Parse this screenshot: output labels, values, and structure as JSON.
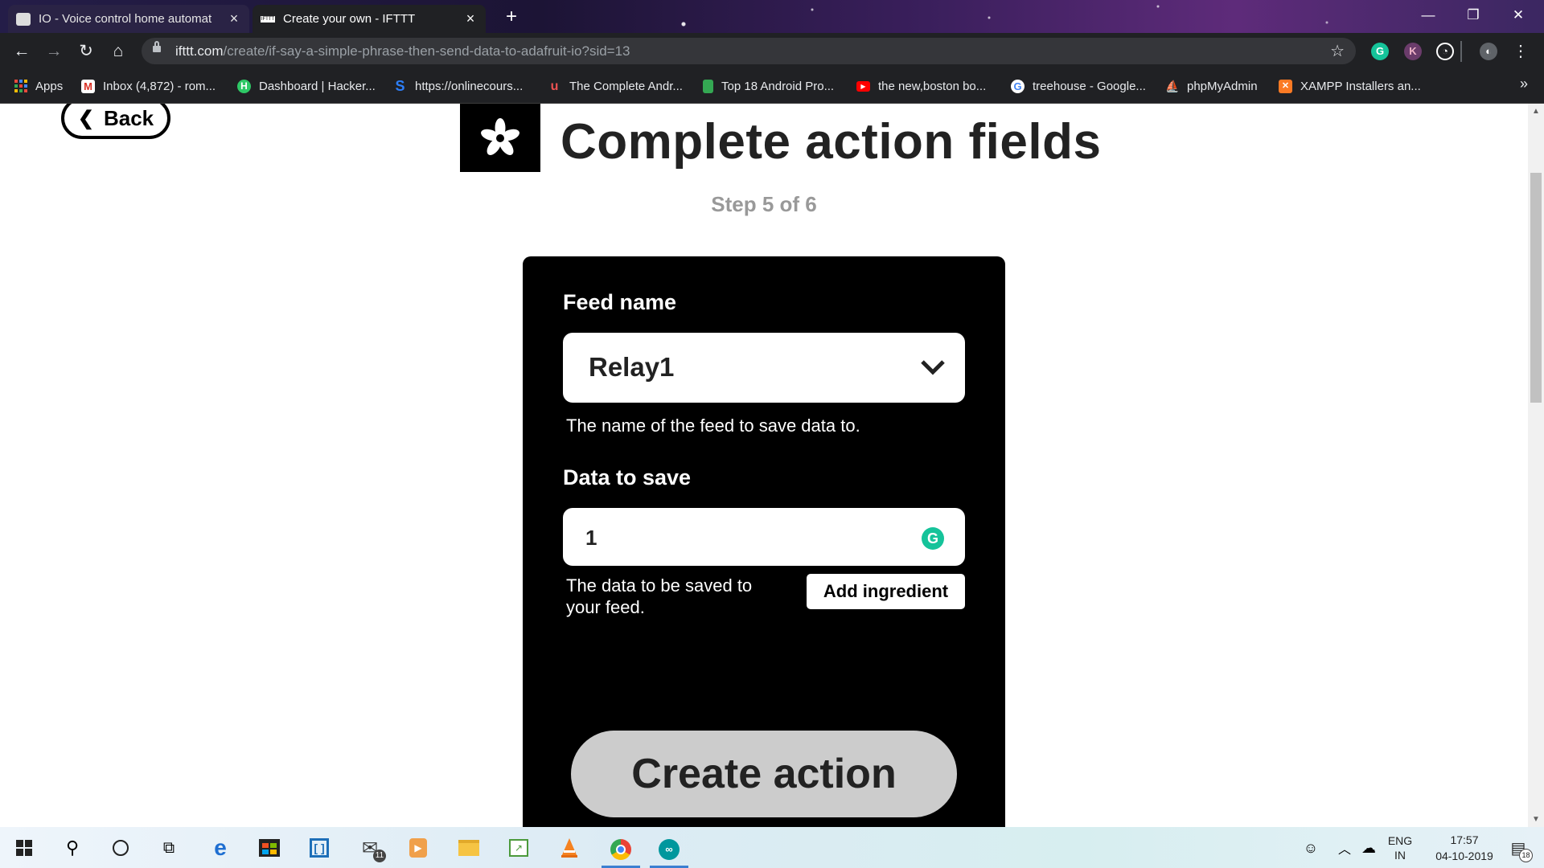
{
  "browser": {
    "tabs": [
      {
        "title": "IO - Voice control home automat",
        "active": false
      },
      {
        "title": "Create your own - IFTTT",
        "active": true
      }
    ],
    "url_host": "ifttt.com",
    "url_path": "/create/if-say-a-simple-phrase-then-send-data-to-adafruit-io?sid=13",
    "extensions": [
      {
        "name": "grammarly-extension-icon",
        "letter": "G",
        "color": "#15c39a"
      },
      {
        "name": "profile-k-extension-icon",
        "letter": "K",
        "color": "#7a4a7a"
      }
    ]
  },
  "bookmarks": [
    {
      "label": "Apps",
      "icon": "apps-grid-icon"
    },
    {
      "label": "Inbox (4,872) - rom...",
      "icon": "gmail-icon",
      "color": "#d93025"
    },
    {
      "label": "Dashboard | Hacker...",
      "icon": "hackerrank-icon",
      "color": "#2ec866"
    },
    {
      "label": "https://onlinecours...",
      "icon": "skillshare-icon",
      "color": "#2d7ff9"
    },
    {
      "label": "The Complete Andr...",
      "icon": "udemy-icon",
      "color": "#ec5252"
    },
    {
      "label": "Top 18 Android Pro...",
      "icon": "document-icon",
      "color": "#34a853"
    },
    {
      "label": "the new,boston bo...",
      "icon": "youtube-icon",
      "color": "#ff0000"
    },
    {
      "label": "treehouse - Google...",
      "icon": "google-icon",
      "color": "#4285f4"
    },
    {
      "label": "phpMyAdmin",
      "icon": "phpmyadmin-icon",
      "color": "#f29111"
    },
    {
      "label": "XAMPP Installers an...",
      "icon": "xampp-icon",
      "color": "#fb7a24"
    }
  ],
  "page": {
    "back_label": "Back",
    "title": "Complete action fields",
    "step": "Step 5 of 6",
    "feed_name_label": "Feed name",
    "feed_name_value": "Relay1",
    "feed_name_help": "The name of the feed to save data to.",
    "data_label": "Data to save",
    "data_value": "1",
    "data_help": "The data to be saved to your feed.",
    "add_ingredient_label": "Add ingredient",
    "create_action_label": "Create action"
  },
  "taskbar": {
    "mail_badge": "11",
    "language_line1": "ENG",
    "language_line2": "IN",
    "time": "17:57",
    "date": "04-10-2019",
    "notification_count": "18"
  }
}
